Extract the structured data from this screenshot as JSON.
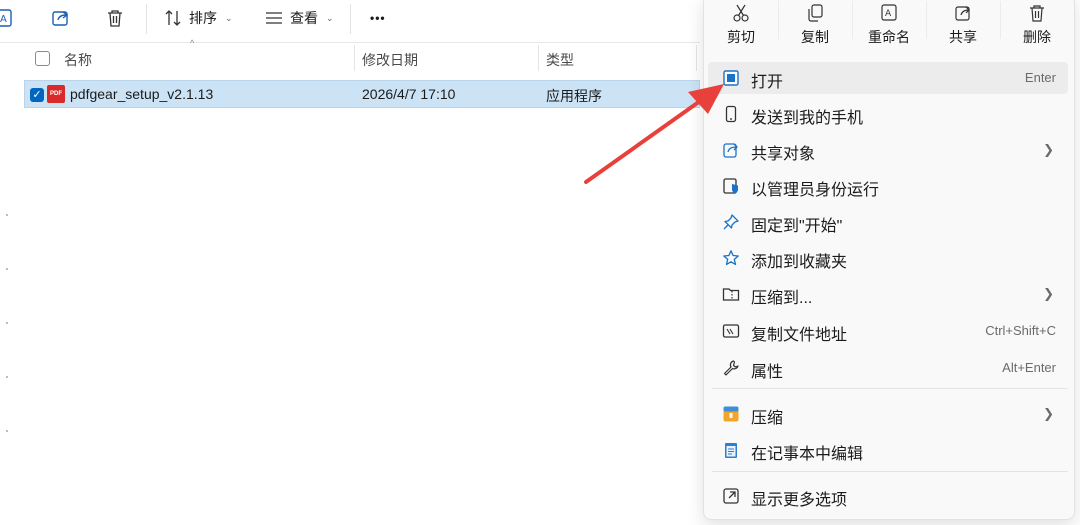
{
  "toolbar": {
    "sort_label": "排序",
    "view_label": "查看",
    "more_label": "•••"
  },
  "header": {
    "name_col": "名称",
    "date_col": "修改日期",
    "type_col": "类型"
  },
  "file": {
    "icon_text": "PDF",
    "name": "pdfgear_setup_v2.1.13",
    "date": "2026/4/7 17:10",
    "type": "应用程序"
  },
  "menu": {
    "quick": [
      {
        "label": "剪切",
        "icon": "scissors-icon"
      },
      {
        "label": "复制",
        "icon": "copy-icon"
      },
      {
        "label": "重命名",
        "icon": "rename-icon"
      },
      {
        "label": "共享",
        "icon": "share-icon"
      },
      {
        "label": "删除",
        "icon": "delete-icon"
      }
    ],
    "items": [
      {
        "label": "打开",
        "shortcut": "Enter",
        "icon": "open-app-icon"
      },
      {
        "label": "发送到我的手机",
        "icon": "phone-icon"
      },
      {
        "label": "共享对象",
        "icon": "share-icon"
      },
      {
        "label": "以管理员身份运行",
        "icon": "admin-shield-icon"
      },
      {
        "label": "固定到\"开始\"",
        "icon": "pin-icon"
      },
      {
        "label": "添加到收藏夹",
        "icon": "star-icon"
      },
      {
        "label": "压缩到...",
        "icon": "zip-folder-icon"
      },
      {
        "label": "复制文件地址",
        "shortcut": "Ctrl+Shift+C",
        "icon": "copy-path-icon"
      },
      {
        "label": "属性",
        "shortcut": "Alt+Enter",
        "icon": "wrench-icon"
      },
      {
        "label": "压缩",
        "icon": "archive-icon"
      },
      {
        "label": "在记事本中编辑",
        "icon": "notepad-icon"
      },
      {
        "label": "显示更多选项",
        "icon": "more-options-icon"
      }
    ]
  },
  "colors": {
    "accent": "#0067c0",
    "selection": "#cce3f5",
    "arrow": "#e8403a",
    "menu_bg": "#f9f9f9"
  }
}
